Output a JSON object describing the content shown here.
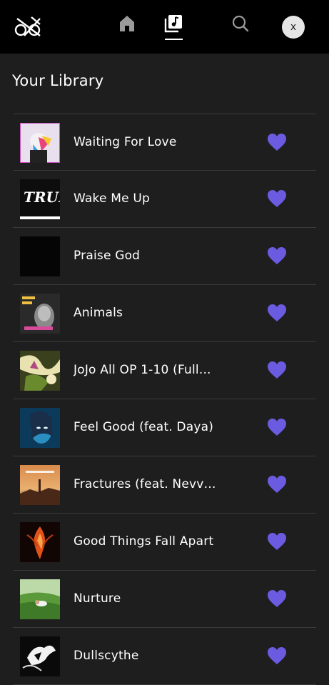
{
  "app": {
    "nav": {
      "home_icon": "home-icon",
      "library_icon": "library-music-icon",
      "search_icon": "search-icon",
      "avatar_letter": "x"
    },
    "colors": {
      "accent": "#6b5be0",
      "background": "#1e1e1e",
      "topbar": "#000000"
    }
  },
  "library": {
    "title": "Your Library",
    "tracks": [
      {
        "title": "Waiting For Love",
        "liked": true
      },
      {
        "title": "Wake Me Up",
        "liked": true
      },
      {
        "title": "Praise God",
        "liked": true
      },
      {
        "title": "Animals",
        "liked": true
      },
      {
        "title": "JoJo All OP 1-10 (Full...",
        "liked": true
      },
      {
        "title": "Feel Good (feat. Daya)",
        "liked": true
      },
      {
        "title": "Fractures (feat. Nevve)",
        "liked": true
      },
      {
        "title": "Good Things Fall Apart",
        "liked": true
      },
      {
        "title": "Nurture",
        "liked": true
      },
      {
        "title": "Dullscythe",
        "liked": true
      }
    ]
  }
}
